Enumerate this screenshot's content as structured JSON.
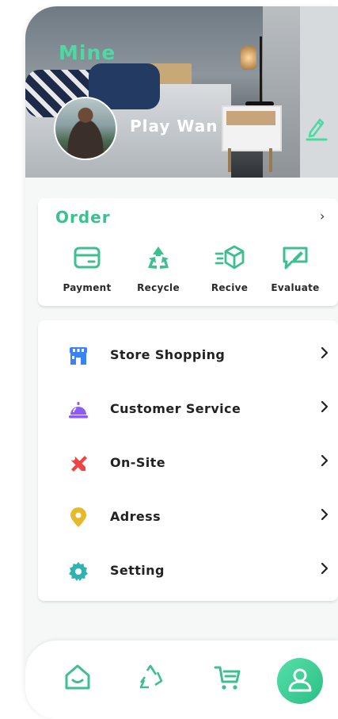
{
  "header": {
    "title": "Mine",
    "username": "Play Wan"
  },
  "order": {
    "title": "Order",
    "arrow": "›",
    "items": [
      {
        "label": "Payment",
        "icon": "card-icon"
      },
      {
        "label": "Recycle",
        "icon": "recycle-icon"
      },
      {
        "label": "Recive",
        "icon": "box-icon"
      },
      {
        "label": "Evaluate",
        "icon": "comment-edit-icon"
      }
    ]
  },
  "menu": {
    "items": [
      {
        "label": "Store Shopping",
        "icon": "store-icon",
        "color": "#3b82f6"
      },
      {
        "label": "Customer Service",
        "icon": "service-bell-icon",
        "color": "#8b5cf6"
      },
      {
        "label": "On-Site",
        "icon": "tools-icon",
        "color": "#ef4444"
      },
      {
        "label": "Adress",
        "icon": "location-pin-icon",
        "color": "#e5b92a"
      },
      {
        "label": "Setting",
        "icon": "gear-icon",
        "color": "#2fb3b0"
      }
    ]
  },
  "nav": {
    "items": [
      "home-icon",
      "recycle-icon",
      "cart-icon",
      "user-icon"
    ],
    "active": "user-icon"
  },
  "colors": {
    "accent": "#3dbf8f",
    "accent_light": "#4fd8a3"
  }
}
